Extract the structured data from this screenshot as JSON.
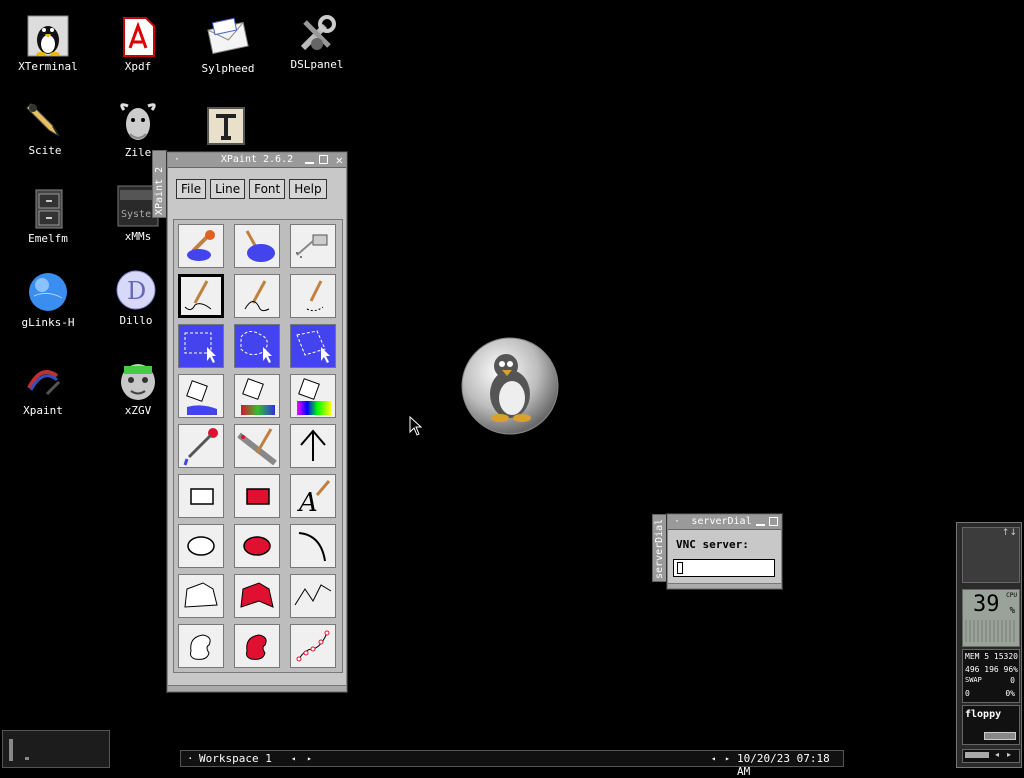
{
  "desktop": {
    "icons": [
      {
        "label": "XTerminal"
      },
      {
        "label": "Xpdf"
      },
      {
        "label": "Sylpheed"
      },
      {
        "label": "DSLpanel"
      },
      {
        "label": "Scite"
      },
      {
        "label": "Zile"
      },
      {
        "label": "Emelfm"
      },
      {
        "label": "xMMs"
      },
      {
        "label": "gLinks-H"
      },
      {
        "label": "Dillo"
      },
      {
        "label": "Xpaint"
      },
      {
        "label": "xZGV"
      }
    ]
  },
  "xpaint": {
    "title": "XPaint 2.6.2",
    "side_tab": "XPaint 2",
    "menu": {
      "file": "File",
      "line": "Line",
      "font": "Font",
      "help": "Help"
    },
    "font_tool_letter": "A"
  },
  "server_dial": {
    "title": "serverDial",
    "side_tab": "serverDial",
    "label": "VNC server:",
    "input_value": ""
  },
  "taskbar": {
    "workspace": "Workspace 1",
    "clock": "10/20/23 07:18 AM"
  },
  "monitor": {
    "cpu_percent": "39",
    "cpu_label": "CPU",
    "mem_line": "MEM 5 15320",
    "mem_values": "496 196 96%",
    "swap_label": "SWAP",
    "swap_value": "0",
    "swap_row2_left": "0",
    "swap_row2_right": "0%",
    "floppy_label": "floppy"
  },
  "colors": {
    "desktop_bg": "#000000",
    "tool_blue": "#4444ee",
    "tool_red": "#e01030"
  }
}
